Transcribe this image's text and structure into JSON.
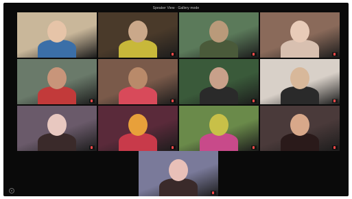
{
  "app": {
    "meeting_title": "Speaker View · Gallery mode"
  },
  "colors": {
    "background": "#0a0a0a",
    "active_speaker_border": "#6bd36b",
    "muted_mic": "#ff4a4a"
  },
  "participants": [
    {
      "name": "",
      "muted": false,
      "active": false,
      "palette": [
        "#c9b79a",
        "#3b6fa8",
        "#e6c4a8"
      ]
    },
    {
      "name": "",
      "muted": true,
      "active": false,
      "palette": [
        "#4a3a2a",
        "#c8b83a",
        "#caa88a"
      ]
    },
    {
      "name": "",
      "muted": true,
      "active": false,
      "palette": [
        "#5b7a5a",
        "#4a5a3a",
        "#b99a7a"
      ]
    },
    {
      "name": "",
      "muted": true,
      "active": false,
      "palette": [
        "#8a6a5a",
        "#d8c0b0",
        "#e8cbb8"
      ]
    },
    {
      "name": "",
      "muted": true,
      "active": false,
      "palette": [
        "#6a7a6a",
        "#c23a3a",
        "#c8957a"
      ]
    },
    {
      "name": "",
      "muted": true,
      "active": false,
      "palette": [
        "#7a5a4a",
        "#d84a5a",
        "#b98a6a"
      ]
    },
    {
      "name": "",
      "muted": true,
      "active": false,
      "palette": [
        "#3a5a3a",
        "#2a2a2a",
        "#c8a08a"
      ]
    },
    {
      "name": "",
      "muted": true,
      "active": false,
      "palette": [
        "#d8d0c8",
        "#2a2a2a",
        "#d8b89a"
      ]
    },
    {
      "name": "",
      "muted": true,
      "active": false,
      "palette": [
        "#6a5a6a",
        "#3a2a2a",
        "#e8c8c0"
      ]
    },
    {
      "name": "",
      "muted": true,
      "active": false,
      "palette": [
        "#5a2a3a",
        "#c83a4a",
        "#e8a03a"
      ]
    },
    {
      "name": "",
      "muted": true,
      "active": false,
      "palette": [
        "#6a8a4a",
        "#c84a8a",
        "#c8c048"
      ]
    },
    {
      "name": "",
      "muted": true,
      "active": false,
      "palette": [
        "#4a3a3a",
        "#2a1a1a",
        "#d8a88a"
      ]
    },
    {
      "name": "",
      "muted": true,
      "active": false,
      "palette": [
        "#7a7a9a",
        "#3a2a2a",
        "#e8c0b8"
      ]
    }
  ]
}
